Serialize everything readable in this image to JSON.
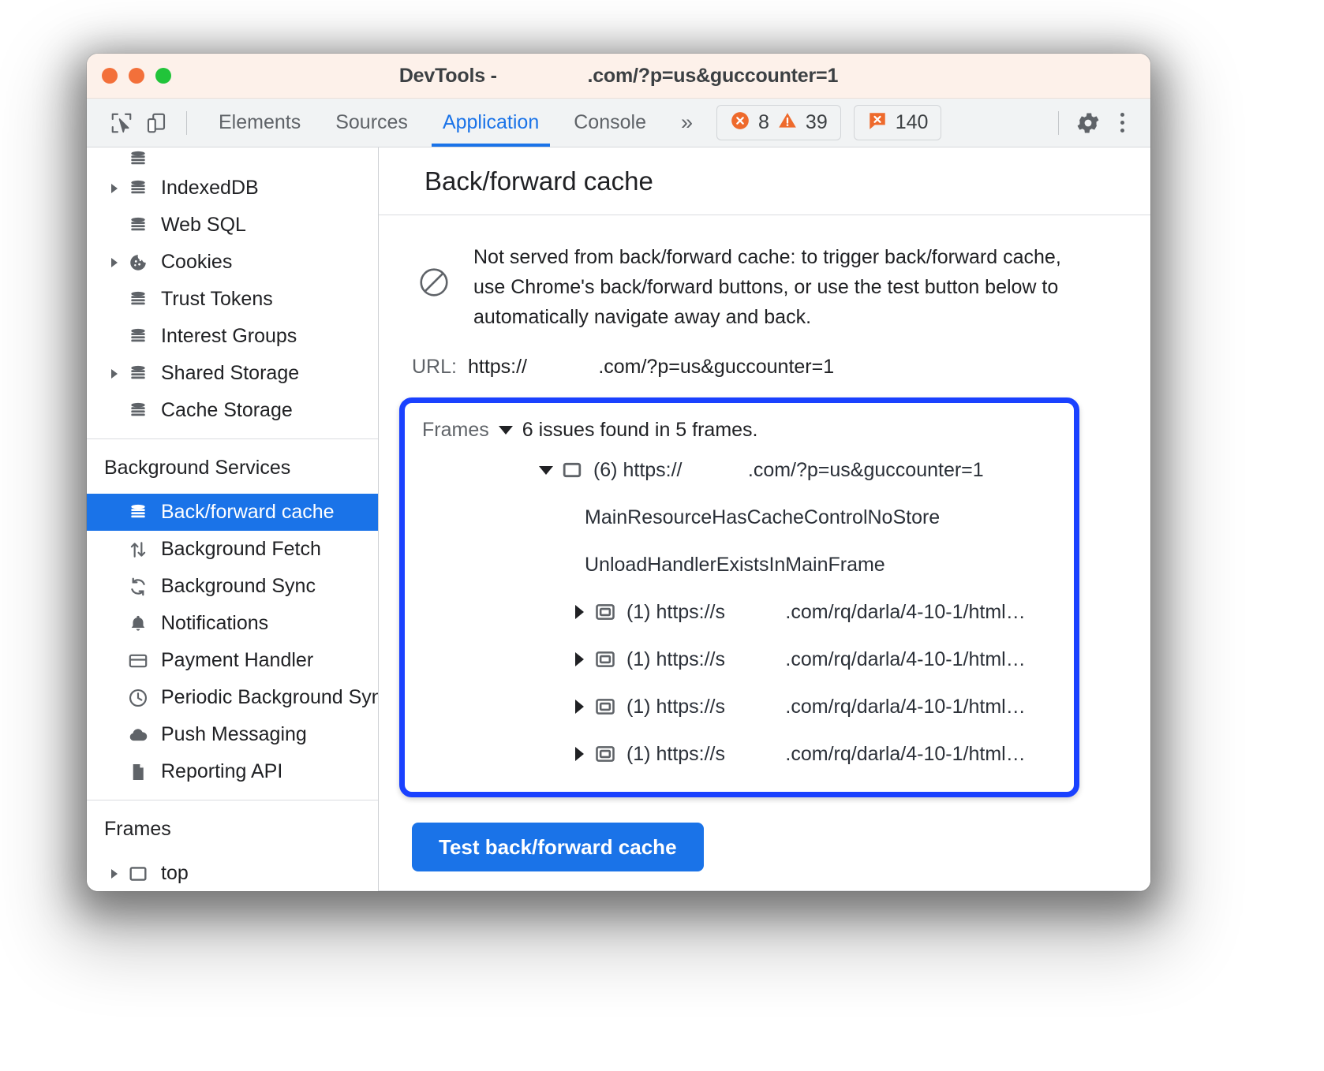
{
  "window": {
    "title_prefix": "DevTools - ",
    "title_redacted": "                ",
    "title_suffix": ".com/?p=us&guccounter=1"
  },
  "toolbar": {
    "inspect_icon": "inspect-cursor-icon",
    "device_icon": "device-toolbar-icon",
    "tabs": [
      {
        "label": "Elements",
        "active": false
      },
      {
        "label": "Sources",
        "active": false
      },
      {
        "label": "Application",
        "active": true
      },
      {
        "label": "Console",
        "active": false
      }
    ],
    "more_tabs": "»",
    "errors_count": "8",
    "warnings_count": "39",
    "issues_count": "140",
    "settings_icon": "gear-icon",
    "menu_icon": "kebab-menu-icon",
    "accent_color": "#1a73e8",
    "error_color": "#ee6a2c",
    "warning_color": "#ee6a2c"
  },
  "sidebar": {
    "storage_items": [
      {
        "label": "IndexedDB",
        "icon": "database-icon",
        "expandable": true
      },
      {
        "label": "Web SQL",
        "icon": "database-icon",
        "expandable": false
      },
      {
        "label": "Cookies",
        "icon": "cookie-icon",
        "expandable": true
      },
      {
        "label": "Trust Tokens",
        "icon": "database-icon",
        "expandable": false
      },
      {
        "label": "Interest Groups",
        "icon": "database-icon",
        "expandable": false
      },
      {
        "label": "Shared Storage",
        "icon": "database-icon",
        "expandable": true
      },
      {
        "label": "Cache Storage",
        "icon": "database-icon",
        "expandable": false
      }
    ],
    "background_services_title": "Background Services",
    "background_services_items": [
      {
        "label": "Back/forward cache",
        "icon": "database-icon",
        "selected": true
      },
      {
        "label": "Background Fetch",
        "icon": "up-down-arrows-icon",
        "selected": false
      },
      {
        "label": "Background Sync",
        "icon": "sync-refresh-icon",
        "selected": false
      },
      {
        "label": "Notifications",
        "icon": "bell-icon",
        "selected": false
      },
      {
        "label": "Payment Handler",
        "icon": "credit-card-icon",
        "selected": false
      },
      {
        "label": "Periodic Background Sync",
        "icon": "clock-icon",
        "selected": false
      },
      {
        "label": "Push Messaging",
        "icon": "cloud-icon",
        "selected": false
      },
      {
        "label": "Reporting API",
        "icon": "document-icon",
        "selected": false
      }
    ],
    "frames_title": "Frames",
    "frames_items": [
      {
        "label": "top",
        "icon": "frame-icon",
        "expandable": true
      }
    ],
    "selected_bg": "#1a73e8"
  },
  "main": {
    "panel_title": "Back/forward cache",
    "status_icon": "blocked-circle-icon",
    "status_text": "Not served from back/forward cache: to trigger back/forward cache, use Chrome's back/forward buttons, or use the test button below to automatically navigate away and back.",
    "url_label": "URL:",
    "url_prefix": "https://",
    "url_redacted": "             ",
    "url_suffix": ".com/?p=us&guccounter=1",
    "frames": {
      "label": "Frames",
      "summary": "6 issues found in 5 frames.",
      "highlight_color": "#1a41ff",
      "rows": [
        {
          "kind": "frame",
          "expanded": true,
          "icon": "frame-icon",
          "count": "(6)",
          "url_prefix": "https://",
          "url_redacted": "            ",
          "url_suffix": ".com/?p=us&guccounter=1",
          "indent": "l1"
        },
        {
          "kind": "reason",
          "text": "MainResourceHasCacheControlNoStore"
        },
        {
          "kind": "reason",
          "text": "UnloadHandlerExistsInMainFrame"
        },
        {
          "kind": "frame",
          "expanded": false,
          "icon": "iframe-icon",
          "count": "(1)",
          "url_prefix": "https://s",
          "url_redacted": "           ",
          "url_suffix": ".com/rq/darla/4-10-1/html…",
          "indent": "l2"
        },
        {
          "kind": "frame",
          "expanded": false,
          "icon": "iframe-icon",
          "count": "(1)",
          "url_prefix": "https://s",
          "url_redacted": "           ",
          "url_suffix": ".com/rq/darla/4-10-1/html…",
          "indent": "l2"
        },
        {
          "kind": "frame",
          "expanded": false,
          "icon": "iframe-icon",
          "count": "(1)",
          "url_prefix": "https://s",
          "url_redacted": "           ",
          "url_suffix": ".com/rq/darla/4-10-1/html…",
          "indent": "l2"
        },
        {
          "kind": "frame",
          "expanded": false,
          "icon": "iframe-icon",
          "count": "(1)",
          "url_prefix": "https://s",
          "url_redacted": "           ",
          "url_suffix": ".com/rq/darla/4-10-1/html…",
          "indent": "l2"
        }
      ]
    },
    "test_button_label": "Test back/forward cache"
  }
}
